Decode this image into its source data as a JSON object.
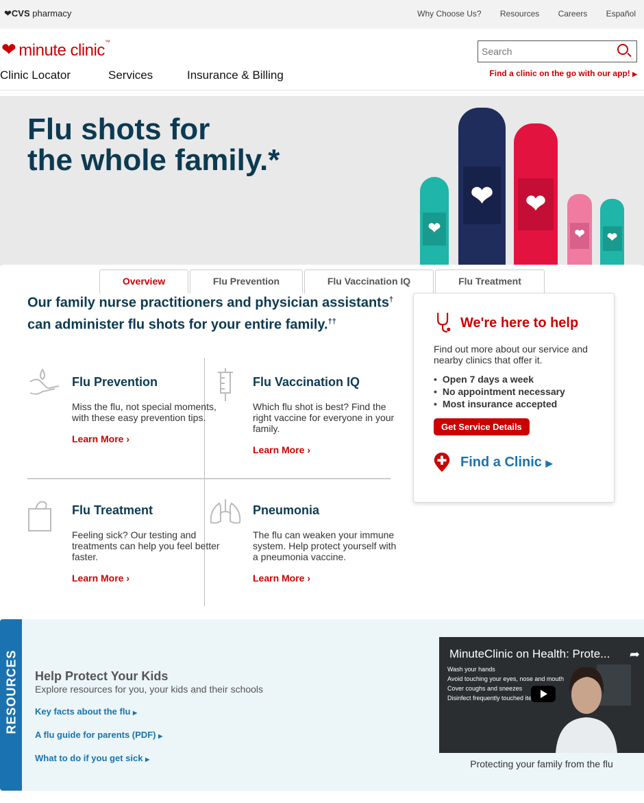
{
  "topbar": {
    "logo_brand": "CVS",
    "logo_sub": "pharmacy",
    "links": [
      "Why Choose Us?",
      "Resources",
      "Careers",
      "Español"
    ]
  },
  "header": {
    "logo_text": "minute clinic",
    "logo_tm": "™",
    "nav": [
      "Clinic Locator",
      "Services",
      "Insurance & Billing"
    ],
    "search_placeholder": "Search",
    "app_link": "Find a clinic on the go with our app!"
  },
  "hero": {
    "title_line1": "Flu shots for",
    "title_line2": "the whole family.*"
  },
  "tabs": [
    "Overview",
    "Flu Prevention",
    "Flu Vaccination IQ",
    "Flu Treatment"
  ],
  "intro": {
    "text": "Our family nurse practitioners and physician assistants",
    "dagger": "†",
    "text2": " can administer flu shots for your entire family.",
    "dagger2": "††"
  },
  "cards": [
    {
      "title": "Flu Prevention",
      "body": "Miss the flu, not special moments, with these easy prevention tips.",
      "link": "Learn More"
    },
    {
      "title": "Flu Vaccination IQ",
      "body": "Which flu shot is best? Find the right vaccine for everyone in your family.",
      "link": "Learn More"
    },
    {
      "title": "Flu Treatment",
      "body": "Feeling sick? Our testing and treatments can help you feel better faster.",
      "link": "Learn More"
    },
    {
      "title": "Pneumonia",
      "body": "The flu can weaken your immune system. Help protect yourself with a pneumonia vaccine.",
      "link": "Learn More"
    }
  ],
  "help": {
    "title": "We're here to help",
    "blurb": "Find out more about our service and nearby clinics that offer it.",
    "bullets": [
      "Open 7 days a week",
      "No appointment necessary",
      "Most insurance accepted"
    ],
    "button": "Get Service Details",
    "find_clinic": "Find a Clinic"
  },
  "resources": {
    "tab_label": "RESOURCES",
    "title": "Help Protect Your Kids",
    "subtitle": "Explore resources for you, your kids and their schools",
    "links": [
      "Key facts about the flu",
      "A flu guide for parents (PDF)",
      "What to do if you get sick"
    ],
    "video_title": "MinuteClinic on Health: Prote...",
    "video_bullets": [
      "Wash your hands",
      "Avoid touching your eyes, nose and mouth",
      "Cover coughs and sneezes",
      "Disinfect frequently touched items"
    ],
    "video_caption": "Protecting your family from the flu"
  },
  "colors": {
    "brand_red": "#cc0000",
    "navy": "#0c3a52",
    "link_blue": "#1a73b0",
    "teal": "#1fb5a8",
    "crimson": "#e3133f",
    "pink": "#f07ba0"
  }
}
